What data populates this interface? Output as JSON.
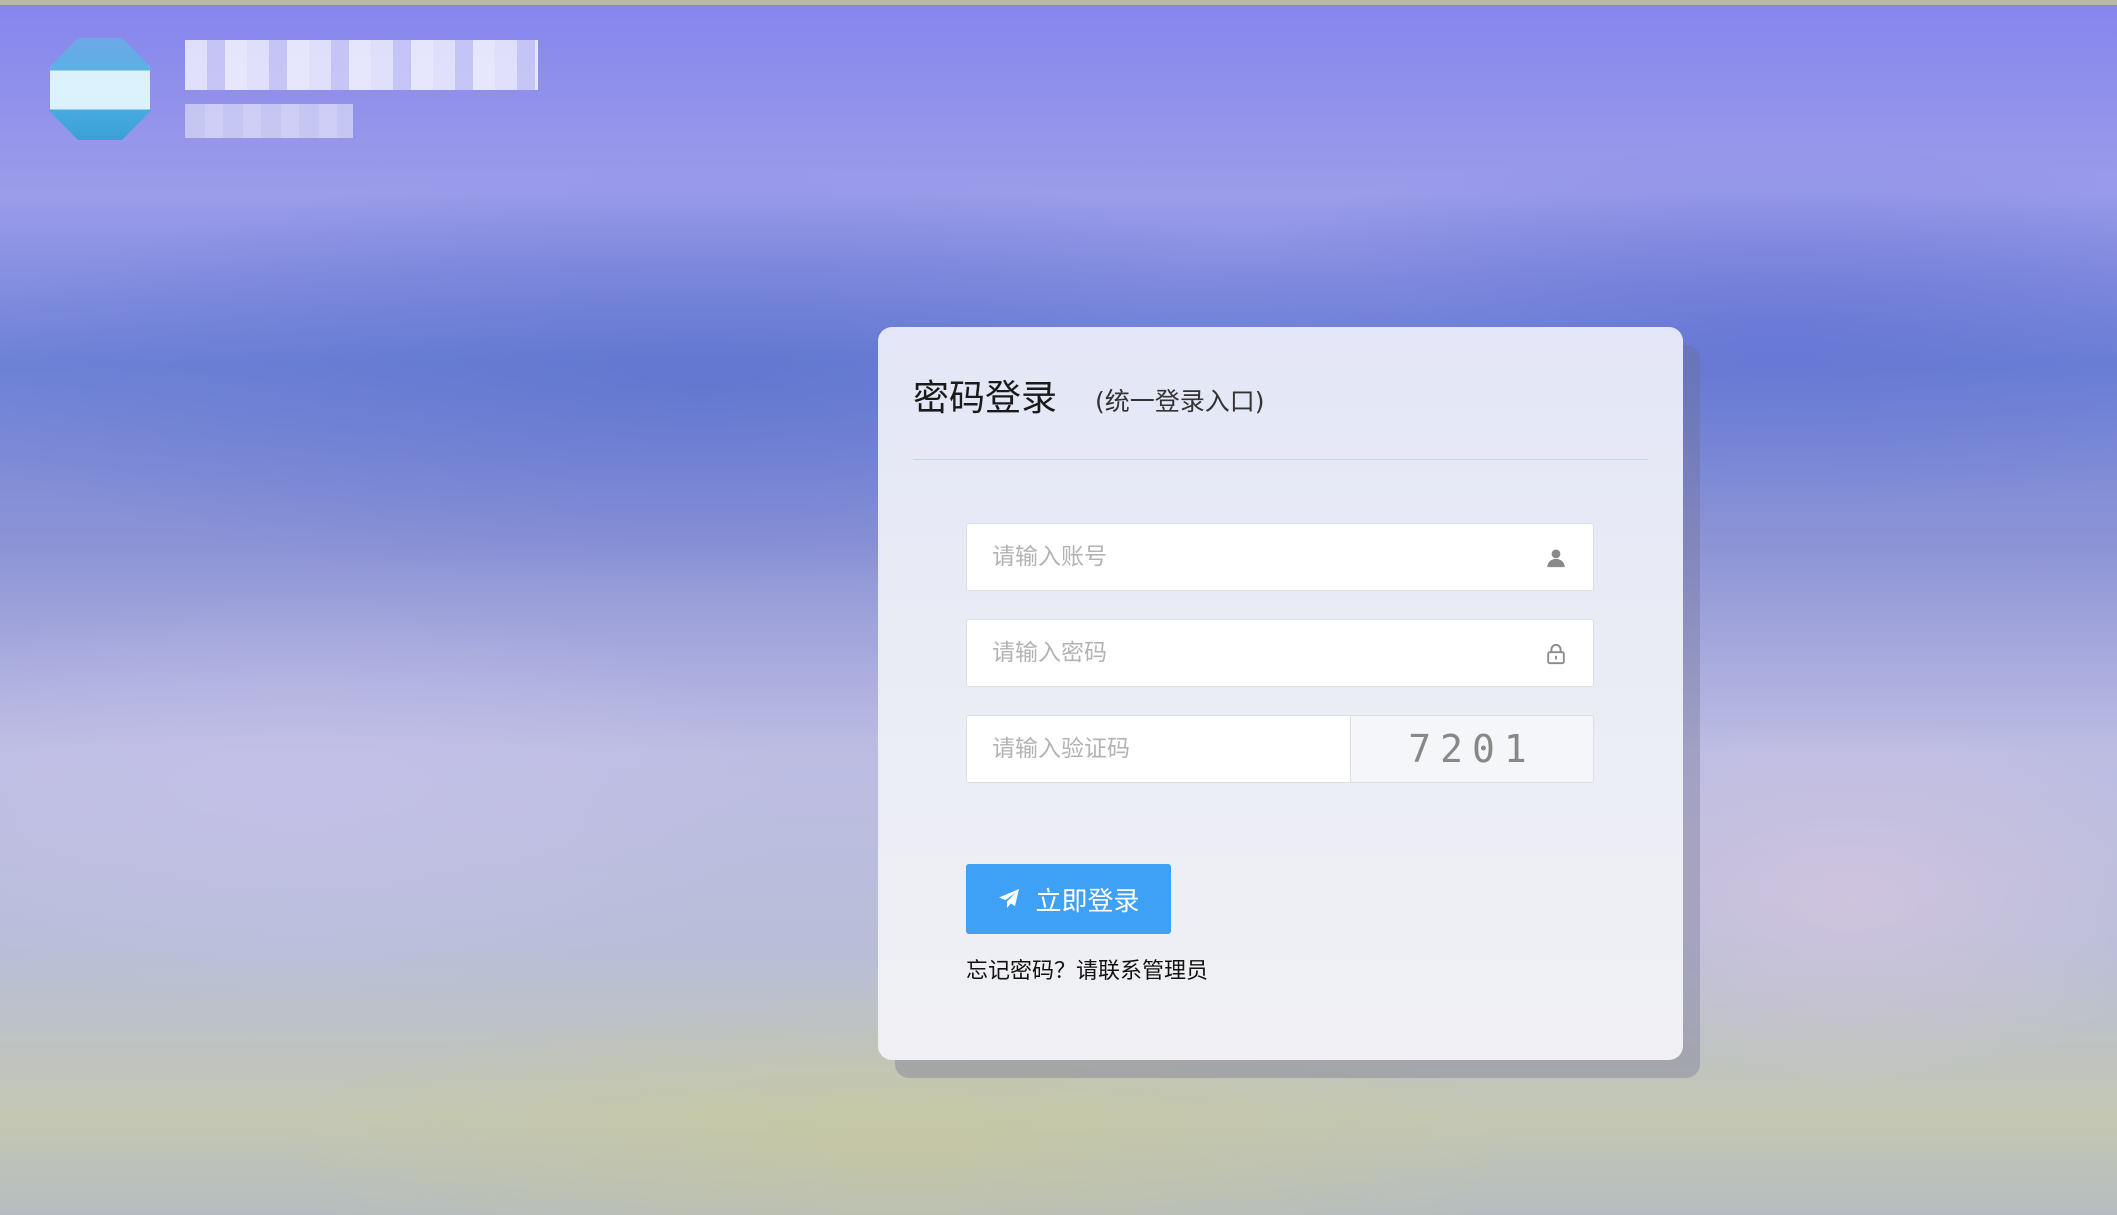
{
  "colors": {
    "primary_button": "#3fa1f5",
    "divider": "#b9dde6",
    "card_bg": "#eceef5"
  },
  "brand": {
    "logo_icon": "brand-logo-icon",
    "name_text": "",
    "sub_text": ""
  },
  "login_card": {
    "title": "密码登录",
    "subtitle": "(统一登录入口)",
    "account": {
      "placeholder": "请输入账号",
      "value": "",
      "icon": "user-icon"
    },
    "password": {
      "placeholder": "请输入密码",
      "value": "",
      "icon": "lock-icon"
    },
    "captcha": {
      "placeholder": "请输入验证码",
      "value": "",
      "code": "7201"
    },
    "submit": {
      "label": "立即登录",
      "icon": "paper-plane-icon"
    },
    "forgot_text": "忘记密码？请联系管理员"
  }
}
